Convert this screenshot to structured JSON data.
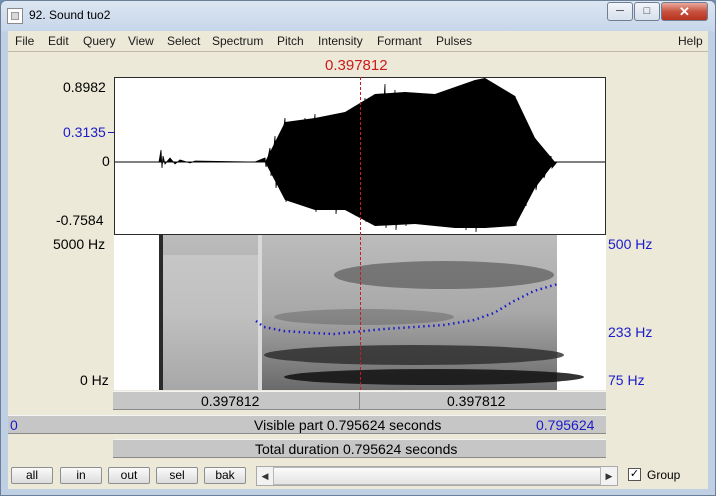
{
  "window": {
    "title": "92. Sound tuo2",
    "minimize_glyph": "─",
    "maximize_glyph": "□",
    "close_glyph": "✕"
  },
  "menu": [
    "File",
    "Edit",
    "Query",
    "View",
    "Select",
    "Spectrum",
    "Pitch",
    "Intensity",
    "Formant",
    "Pulses"
  ],
  "help": "Help",
  "cursor": {
    "time_label": "0.397812",
    "color": "#cc1a1a"
  },
  "waveform": {
    "ymax": "0.8982",
    "ymark": "0.3135",
    "yzero": "0",
    "ymin": "-0.7584"
  },
  "spectrogram": {
    "freq_top": "5000 Hz",
    "freq_bottom": "0 Hz"
  },
  "pitch_axis": {
    "top": "500 Hz",
    "mid": "233 Hz",
    "bottom": "75 Hz",
    "color": "#1a1acc"
  },
  "selection_bar": {
    "left": "0.397812",
    "right": "0.397812"
  },
  "visible_bar": {
    "start": "0",
    "label": "Visible part 0.795624 seconds",
    "end": "0.795624"
  },
  "total_bar": {
    "label": "Total duration 0.795624 seconds"
  },
  "buttons": {
    "all": "all",
    "in": "in",
    "out": "out",
    "sel": "sel",
    "bak": "bak"
  },
  "scroll": {
    "left_arrow": "◀",
    "right_arrow": "▶"
  },
  "group": {
    "label": "Group",
    "checked": "✓"
  }
}
